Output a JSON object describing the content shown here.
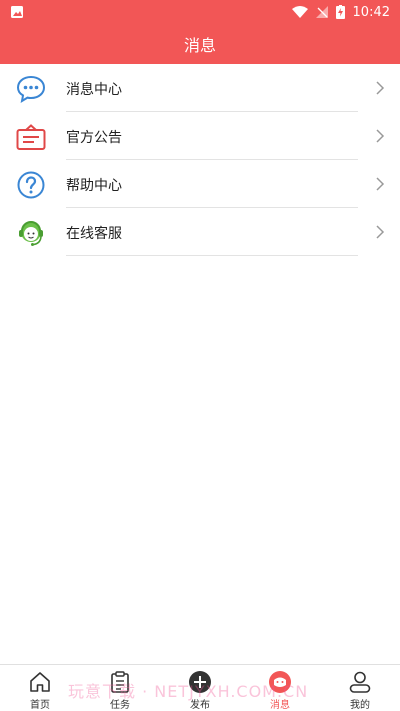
{
  "status_bar": {
    "time": "10:42"
  },
  "header": {
    "title": "消息"
  },
  "menu": {
    "items": [
      {
        "label": "消息中心",
        "icon": "chat-bubble-icon"
      },
      {
        "label": "官方公告",
        "icon": "announcement-icon"
      },
      {
        "label": "帮助中心",
        "icon": "help-icon"
      },
      {
        "label": "在线客服",
        "icon": "customer-service-icon"
      }
    ]
  },
  "tabbar": {
    "items": [
      {
        "label": "首页",
        "icon": "home-icon"
      },
      {
        "label": "任务",
        "icon": "clipboard-icon"
      },
      {
        "label": "发布",
        "icon": "publish-icon"
      },
      {
        "label": "消息",
        "icon": "message-icon",
        "active": true
      },
      {
        "label": "我的",
        "icon": "profile-icon"
      }
    ]
  },
  "watermark": "玩意下载 · NETJYXH.COM.CN",
  "colors": {
    "accent": "#f25656",
    "blue": "#3a86d4",
    "red": "#e04848",
    "green": "#6cc04a"
  }
}
